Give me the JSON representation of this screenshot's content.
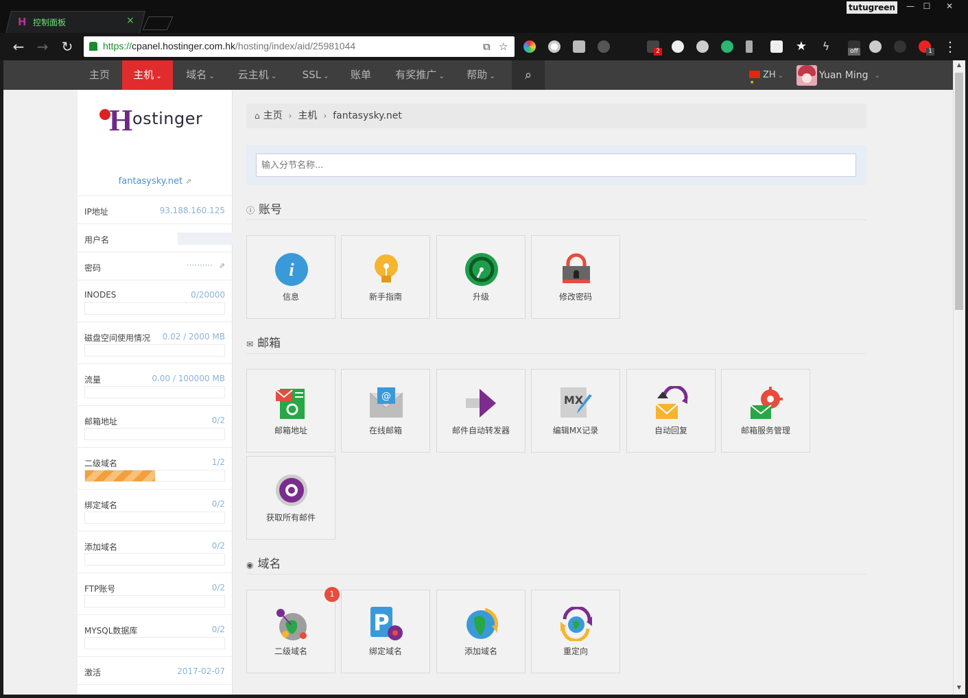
{
  "browser": {
    "tab_title": "控制面板",
    "tab_close": "×",
    "profile": "tutugreen",
    "win_min": "—",
    "win_max": "☐",
    "win_close": "✕",
    "url_scheme": "https://",
    "url_host": "cpanel.hostinger.com.hk",
    "url_path": "/hosting/index/aid/25981044",
    "ext_badges": [
      "2",
      "off",
      "1"
    ]
  },
  "nav": {
    "items": [
      {
        "label": "主页",
        "caret": ""
      },
      {
        "label": "主机",
        "caret": "⌄"
      },
      {
        "label": "域名",
        "caret": "⌄"
      },
      {
        "label": "云主机",
        "caret": "⌄"
      },
      {
        "label": "SSL",
        "caret": "⌄"
      },
      {
        "label": "账单",
        "caret": ""
      },
      {
        "label": "有奖推广",
        "caret": "⌄"
      },
      {
        "label": "帮助",
        "caret": "⌄"
      }
    ],
    "lang": "ZH",
    "user": "Yuan Ming"
  },
  "sidebar": {
    "logo_text": "ostinger",
    "logo_h": "H",
    "site": "fantasysky.net",
    "stats": [
      {
        "label": "IP地址",
        "value": "93.188.160.125"
      },
      {
        "label": "用户名",
        "value": ""
      },
      {
        "label": "密码",
        "value": "··········"
      },
      {
        "label": "INODES",
        "value": "0/20000",
        "fraction": 0
      },
      {
        "label": "磁盘空间使用情况",
        "value": "0.02 / 2000 MB",
        "fraction": 0
      },
      {
        "label": "流量",
        "value": "0.00 / 100000 MB",
        "fraction": 0
      },
      {
        "label": "邮箱地址",
        "value": "0/2",
        "fraction": 0
      },
      {
        "label": "二级域名",
        "value": "1/2",
        "fraction": 0.5
      },
      {
        "label": "绑定域名",
        "value": "0/2",
        "fraction": 0
      },
      {
        "label": "添加域名",
        "value": "0/2",
        "fraction": 0
      },
      {
        "label": "FTP账号",
        "value": "0/2",
        "fraction": 0
      },
      {
        "label": "MYSQL数据库",
        "value": "0/2",
        "fraction": 0
      },
      {
        "label": "激活",
        "value": "2017-02-07"
      }
    ]
  },
  "main": {
    "breadcrumb": [
      "主页",
      "主机",
      "fantasysky.net"
    ],
    "search_placeholder": "输入分节名称...",
    "sections": [
      {
        "title": "账号",
        "tiles": [
          "信息",
          "新手指南",
          "升级",
          "修改密码"
        ]
      },
      {
        "title": "邮箱",
        "tiles": [
          "邮箱地址",
          "在线邮箱",
          "邮件自动转发器",
          "编辑MX记录",
          "自动回复",
          "邮箱服务管理",
          "获取所有邮件"
        ]
      },
      {
        "title": "域名",
        "tiles": [
          "二级域名",
          "绑定域名",
          "添加域名",
          "重定向"
        ],
        "badge": "1"
      }
    ]
  },
  "colors": {
    "accent": "#e02c2c",
    "nav_bg": "#3e3e3e",
    "link": "#4a8fd0",
    "progress": "#f2a03c"
  }
}
